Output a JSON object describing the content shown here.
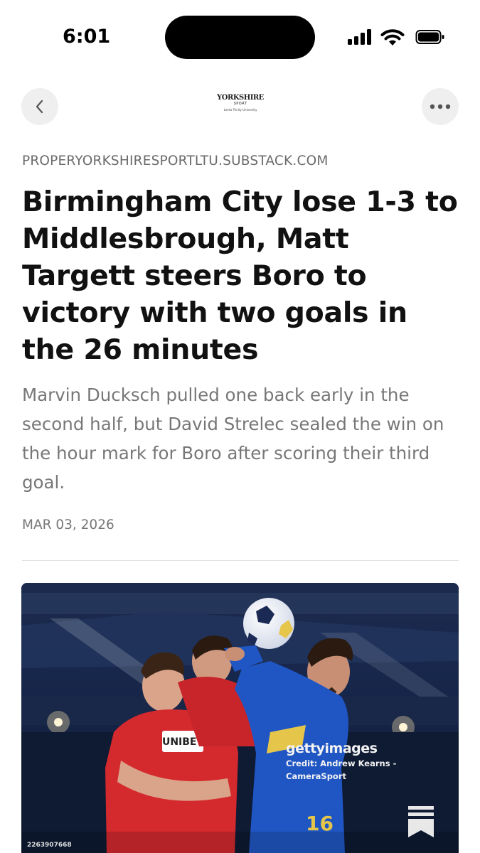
{
  "status_bar": {
    "time": "6:01",
    "icons": [
      "cellular-signal-icon",
      "wifi-icon",
      "battery-icon"
    ]
  },
  "nav": {
    "back_icon": "chevron-left-icon",
    "more_icon": "ellipsis-icon",
    "logo": {
      "title": "YORKSHIRE",
      "subtitle": "SPORT",
      "footer": "Leeds Trinity University"
    }
  },
  "article": {
    "source": "PROPERYORKSHIRESPORTLTU.SUBSTACK.COM",
    "headline": "Birmingham City lose 1-3 to Middlesbrough, Matt Targett steers Boro to victory with two goals in the 26 minutes",
    "subtitle": "Marvin Ducksch pulled one back early in the second half, but David Strelec sealed the win on the hour mark for Boro after scoring their third goal.",
    "date": "MAR 03, 2026"
  },
  "photo": {
    "watermark": "gettyimages",
    "credit_line1": "Credit: Andrew Kearns -",
    "credit_line2": "CameraSport",
    "image_id": "2263907668",
    "shirt_sponsor": "UNIBET",
    "shirt_number": "16",
    "save_icon": "bookmark-stack-icon"
  },
  "colors": {
    "background": "#ffffff",
    "headline": "#111111",
    "muted": "#777777",
    "button_bg": "#efefef",
    "red_kit": "#d42a2e",
    "blue_kit": "#1f56c4"
  }
}
